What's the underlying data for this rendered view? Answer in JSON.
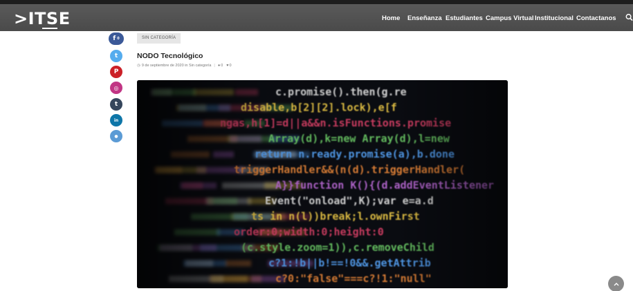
{
  "header": {
    "logo": ">ITSE",
    "nav": [
      {
        "label": "Home"
      },
      {
        "label": "Enseñanza"
      },
      {
        "label": "Estudiantes"
      },
      {
        "label": "Campus Virtual"
      },
      {
        "label": "Institucional"
      },
      {
        "label": "Contactanos"
      }
    ],
    "search_icon": "search-icon"
  },
  "share": [
    {
      "icon": "facebook-icon",
      "color": "#3b5998",
      "glyph": "f",
      "count": "0"
    },
    {
      "icon": "twitter-icon",
      "color": "#55acee",
      "glyph": "t"
    },
    {
      "icon": "pinterest-icon",
      "color": "#cb2027",
      "glyph": "P"
    },
    {
      "icon": "instagram-icon",
      "color": "#c13584",
      "glyph": "◎"
    },
    {
      "icon": "tumblr-icon",
      "color": "#35465c",
      "glyph": "t"
    },
    {
      "icon": "linkedin-icon",
      "color": "#0e76a8",
      "glyph": "in"
    },
    {
      "icon": "vk-icon",
      "color": "#5b9bd5",
      "glyph": "●"
    }
  ],
  "post": {
    "category": "SIN CATEGORÍA",
    "title": "NODO Tecnológico",
    "date": "9 de septiembre de 2020 in Sin categoría",
    "comments": "0",
    "likes": "0"
  },
  "hero_code_lines": [
    "c.promise().then(g.re",
    "disable,b[2][2].lock),e[f",
    "ngas,h[1]=d||a&&n.isFunctions.promise",
    "Array(d),k=new Array(d),l=new",
    "return n.ready.promise(a),b.done",
    "triggerHandler&&(n(d).triggerHandler(",
    "A}}function K(){(d.addEventListener",
    "Event(\"onload\",K);var e=a.d",
    "ts in n(l))break;l.ownFirst",
    "order:0;width:0;height:0",
    "(c.style.zoom=1)),c.removeChild",
    "c?1:!b||b!==!0&&.getAttrib",
    "c?0:\"false\"===c?!1:\"null\""
  ],
  "colors": {
    "header_bg": "#4f4f4f",
    "tag_bg": "#e6e6e6",
    "scrolltop_bg": "#8a8a8a"
  }
}
